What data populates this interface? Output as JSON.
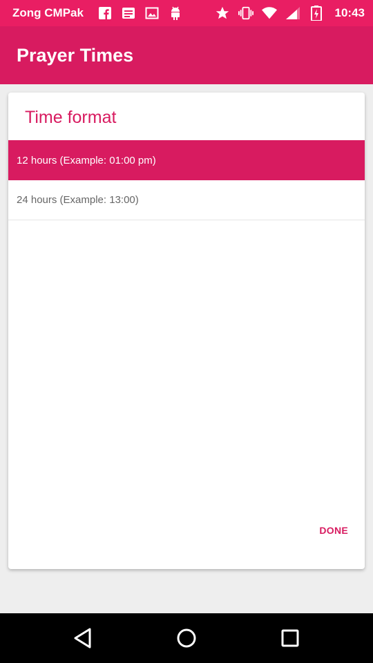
{
  "status_bar": {
    "carrier": "Zong CMPak",
    "time": "10:43",
    "left_icons": [
      "facebook-icon",
      "message-icon",
      "gallery-icon",
      "android-icon"
    ],
    "right_icons": [
      "star-icon",
      "vibrate-icon",
      "wifi-icon",
      "signal-icon",
      "battery-icon"
    ]
  },
  "app_bar": {
    "title": "Prayer Times"
  },
  "dialog": {
    "title": "Time format",
    "options": [
      {
        "label": "12 hours (Example: 01:00 pm)",
        "selected": true
      },
      {
        "label": "24 hours (Example: 13:00)",
        "selected": false
      }
    ],
    "done_label": "DONE"
  },
  "nav_bar": {
    "buttons": [
      "back-icon",
      "home-icon",
      "recents-icon"
    ]
  },
  "colors": {
    "status_bar": "#e91e63",
    "app_bar": "#d81b60",
    "accent": "#d81b60",
    "background": "#eeeeee"
  }
}
